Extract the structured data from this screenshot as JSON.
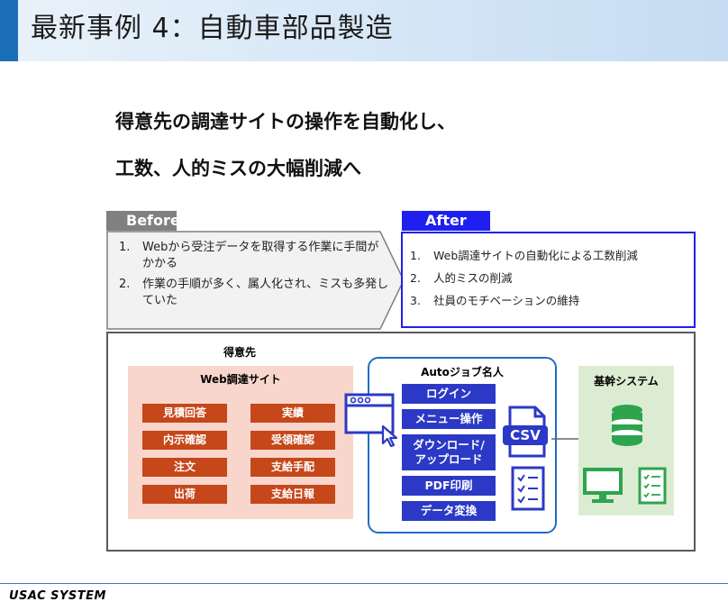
{
  "header": {
    "title": "最新事例 4：自動車部品製造"
  },
  "lead": {
    "line1": "得意先の調達サイトの操作を自動化し、",
    "line2": "工数、人的ミスの大幅削減へ"
  },
  "before": {
    "tag": "Before",
    "items": [
      {
        "num": "1.",
        "text": "Webから受注データを取得する作業に手間がかかる"
      },
      {
        "num": "2.",
        "text": "作業の手順が多く、属人化され、ミスも多発していた"
      }
    ]
  },
  "after": {
    "tag": "After",
    "items": [
      {
        "num": "1.",
        "text": "Web調達サイトの自動化による工数削減"
      },
      {
        "num": "2.",
        "text": "人的ミスの削減"
      },
      {
        "num": "3.",
        "text": "社員のモチベーションの維持"
      }
    ]
  },
  "diagram": {
    "client_label": "得意先",
    "site_label": "Web調達サイト",
    "site_buttons": [
      "見積回答",
      "実績",
      "内示確認",
      "受領確認",
      "注文",
      "支給手配",
      "出荷",
      "支給日報"
    ],
    "robot_label": "Autoジョブ名人",
    "robot_buttons": [
      "ログイン",
      "メニュー操作",
      "ダウンロード/アップロード",
      "PDF印刷",
      "データ変換"
    ],
    "csv_label": "CSV",
    "core_label": "基幹システム",
    "colors": {
      "site_button": "#c5471a",
      "robot_button": "#2b39c6",
      "core_icon": "#2ea44f",
      "after_border": "#2020ef"
    }
  },
  "footer": {
    "logo": "USAC SYSTEM"
  }
}
